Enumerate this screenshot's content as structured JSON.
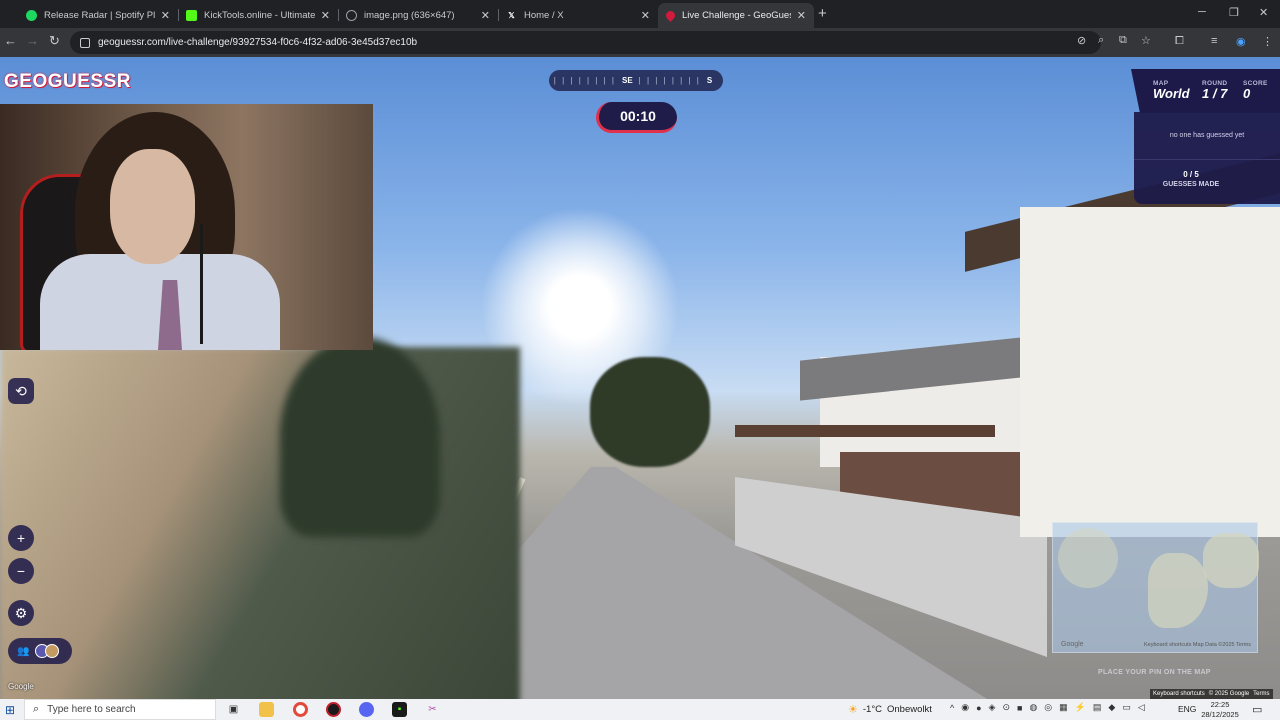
{
  "tabs": [
    {
      "label": "Release Radar | Spotify Playlist",
      "favicon": "spotify-icon",
      "color": "#1ed760",
      "active": false
    },
    {
      "label": "KickTools.online - Ultimate Kick",
      "favicon": "kicktools-icon",
      "color": "#53fc18",
      "active": false
    },
    {
      "label": "image.png (636×647)",
      "favicon": "globe-icon",
      "color": "#9aa0a6",
      "active": false
    },
    {
      "label": "Home / X",
      "favicon": "x-icon",
      "color": "#ffffff",
      "active": false
    },
    {
      "label": "Live Challenge - GeoGuessr",
      "favicon": "geoguessr-pin-icon",
      "color": "#d11b3d",
      "active": true
    }
  ],
  "address_bar": {
    "url": "geoguessr.com/live-challenge/93927534-f0c6-4f32-ad06-3e45d37ec10b"
  },
  "game": {
    "logo_text": "GEOGUESSR",
    "compass": {
      "ticks_left": "| | | | | | | |",
      "primary": "SE",
      "ticks_right": "| | | | | | | |",
      "secondary": "S"
    },
    "timer": "00:10",
    "status": {
      "map_label": "MAP",
      "map_value": "World",
      "round_label": "ROUND",
      "round_value": "1 / 7",
      "score_label": "SCORE",
      "score_value": "0"
    },
    "guesses": {
      "message": "no one has guessed yet",
      "count": "0 / 5",
      "label": "GUESSES MADE"
    },
    "controls": {
      "zoom_in": "+",
      "zoom_out": "−",
      "settings": "⚙",
      "compass_toggle": "⟲",
      "players": "👥"
    },
    "watermark": "Google",
    "minimap": {
      "google": "Google",
      "credits": "Keyboard shortcuts   Map Data ©2025   Terms",
      "place_pin": "PLACE YOUR PIN ON THE MAP"
    },
    "footer": {
      "shortcuts": "Keyboard shortcuts",
      "copyright": "© 2025 Google",
      "terms": "Terms"
    }
  },
  "taskbar": {
    "search_placeholder": "Type here to search",
    "weather_temp": "-1°C",
    "weather_text": "Onbewolkt",
    "language": "ENG",
    "time": "22:25",
    "date": "28/12/2025"
  },
  "colors": {
    "accent": "#d11b3d",
    "panel": "#1d1a4a"
  }
}
